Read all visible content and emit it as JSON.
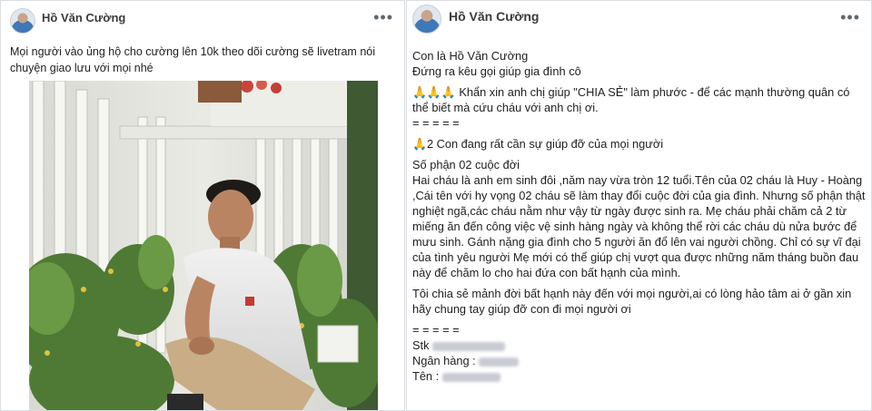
{
  "left_post": {
    "author": "Hồ Văn Cường",
    "more_label": "•••",
    "caption": "Mọi người vào ủng hộ cho cường lên 10k theo dõi cường sẽ livetram nói chuyện giao lưu với mọi nhé"
  },
  "right_post": {
    "author": "Hồ Văn Cường",
    "more_label": "•••",
    "lines": {
      "l1": "Con là Hồ Văn Cường",
      "l2": "Đứng ra kêu gọi giúp gia đình cô",
      "l3_emoji": "🙏🙏🙏",
      "l3": " Khẩn xin anh chị giúp \"CHIA SẺ\" làm phước - để các mạnh thường quân có thể biết mà cứu cháu với anh chị ơi.",
      "sep1": "= = = = =",
      "l4_emoji": "🙏",
      "l4": "2 Con đang rất cần sự giúp đỡ của mọi người",
      "l5": "Số phận 02 cuộc đời",
      "l6": "Hai cháu là anh em sinh đôi ,năm nay vừa tròn 12 tuổi.Tên của 02 cháu là Huy - Hoàng ,Cái tên với hy vọng 02 cháu sẽ làm thay đổi cuộc đời của gia đình. Nhưng số phận thật nghiệt ngã,các cháu nằm như vậy từ ngày được sinh ra. Mẹ cháu phải chăm cả 2 từ miếng ăn đến công việc vệ sinh hàng ngày và không thể rời các cháu dù nửa bước để mưu sinh. Gánh nặng gia đình cho 5 người ăn đổ lên vai người chồng. Chỉ có sự vĩ đại của tình yêu người Mẹ mới có thể giúp chị vượt qua được những năm tháng buồn đau này để chăm lo cho hai đứa con bất hạnh của mình.",
      "l7": "Tôi chia sẻ mảnh đời bất hạnh này đến với mọi người,ai có lòng hảo tâm ai ở gần xin hãy chung tay giúp đỡ con đi mọi người ơi",
      "sep2": "= = = = =",
      "stk": "Stk",
      "bank": "Ngân hàng :",
      "name": "Tên :"
    }
  }
}
